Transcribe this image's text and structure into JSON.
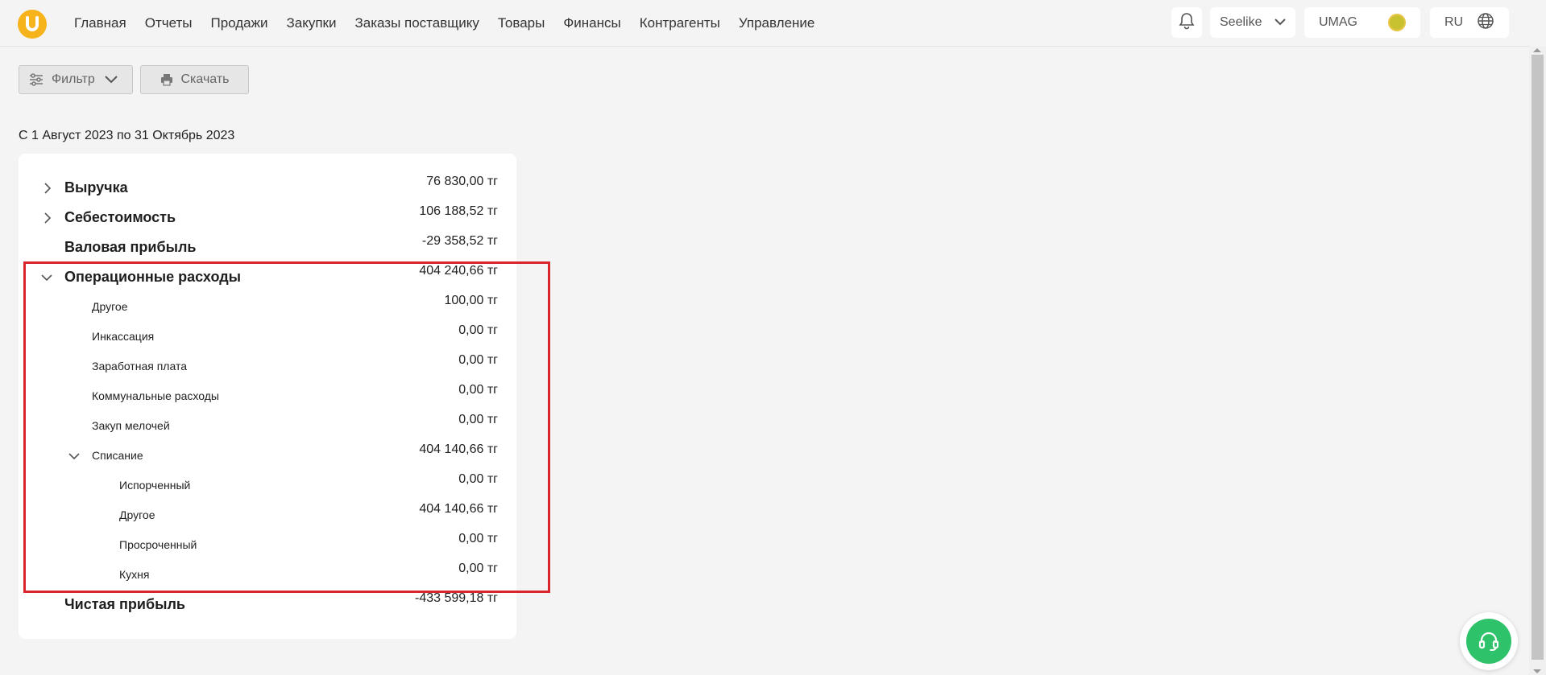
{
  "nav": {
    "items": [
      "Главная",
      "Отчеты",
      "Продажи",
      "Закупки",
      "Заказы поставщику",
      "Товары",
      "Финансы",
      "Контрагенты",
      "Управление"
    ]
  },
  "header": {
    "user_label": "Seelike",
    "org_label": "UMAG",
    "lang_label": "RU"
  },
  "toolbar": {
    "filter_label": "Фильтр",
    "download_label": "Скачать"
  },
  "report": {
    "date_range": "С 1 Август 2023 по 31 Октябрь 2023",
    "rows": [
      {
        "label": "Выручка",
        "value": "76 830,00 тг"
      },
      {
        "label": "Себестоимость",
        "value": "106 188,52 тг"
      },
      {
        "label": "Валовая прибыль",
        "value": "-29 358,52 тг"
      },
      {
        "label": "Операционные расходы",
        "value": "404 240,66 тг"
      },
      {
        "label": "Другое",
        "value": "100,00 тг"
      },
      {
        "label": "Инкассация",
        "value": "0,00 тг"
      },
      {
        "label": "Заработная плата",
        "value": "0,00 тг"
      },
      {
        "label": "Коммунальные расходы",
        "value": "0,00 тг"
      },
      {
        "label": "Закуп мелочей",
        "value": "0,00 тг"
      },
      {
        "label": "Списание",
        "value": "404 140,66 тг"
      },
      {
        "label": "Испорченный",
        "value": "0,00 тг"
      },
      {
        "label": "Другое",
        "value": "404 140,66 тг"
      },
      {
        "label": "Просроченный",
        "value": "0,00 тг"
      },
      {
        "label": "Кухня",
        "value": "0,00 тг"
      },
      {
        "label": "Чистая прибыль",
        "value": "-433 599,18 тг"
      }
    ]
  },
  "colors": {
    "accent_logo": "#f7b31b",
    "highlight": "#d9262c",
    "support": "#2ec26b"
  }
}
